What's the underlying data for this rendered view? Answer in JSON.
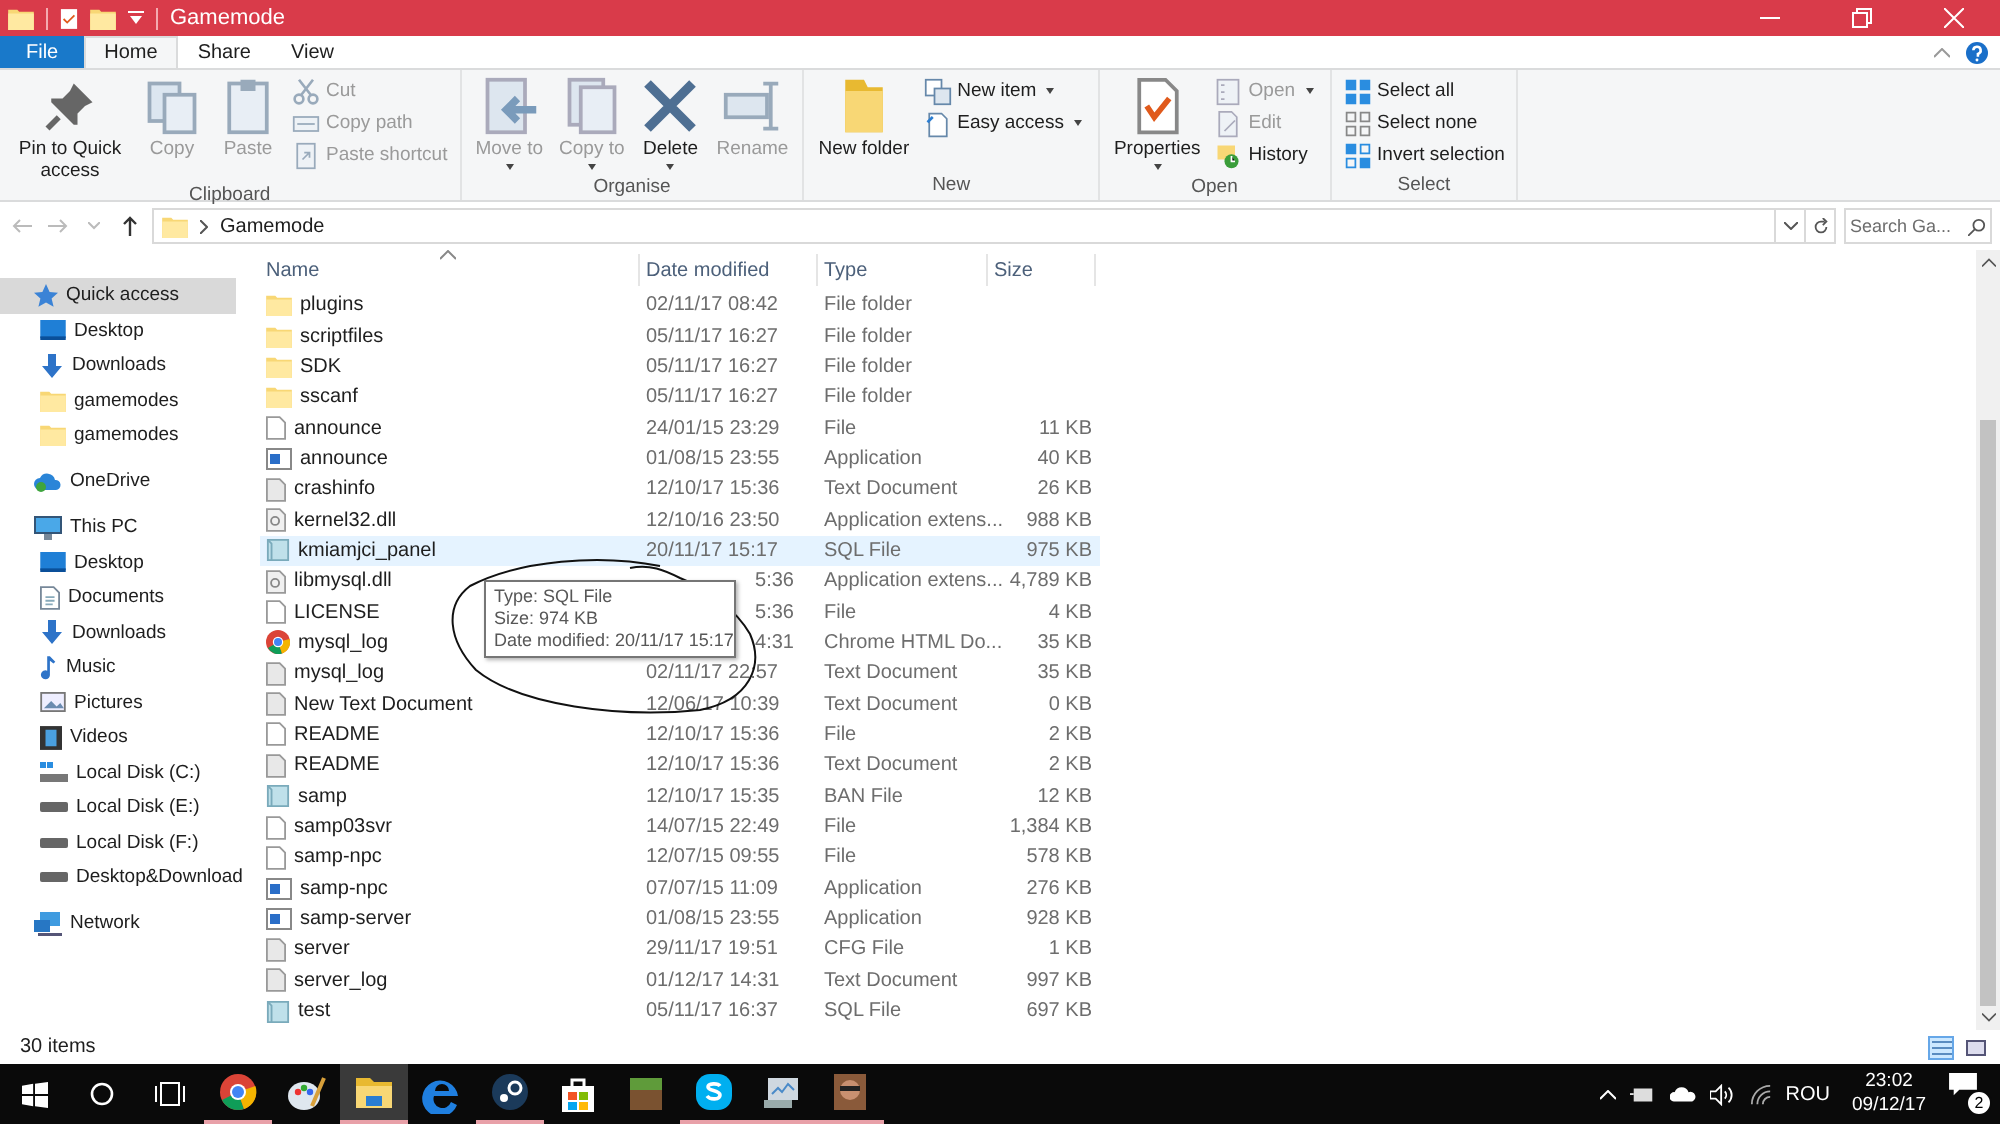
{
  "window": {
    "title": "Gamemode"
  },
  "ribbon_tabs": [
    {
      "label": "File",
      "kind": "file",
      "selected": false
    },
    {
      "label": "Home",
      "kind": "tab",
      "selected": true
    },
    {
      "label": "Share",
      "kind": "tab",
      "selected": false
    },
    {
      "label": "View",
      "kind": "tab",
      "selected": false
    }
  ],
  "ribbon_groups": [
    {
      "label": "Clipboard",
      "items": [
        {
          "kind": "large",
          "label": "Pin to Quick access",
          "disabled": false,
          "dropdown": false
        },
        {
          "kind": "large",
          "label": "Copy",
          "disabled": true,
          "dropdown": false
        },
        {
          "kind": "large",
          "label": "Paste",
          "disabled": true,
          "dropdown": false
        },
        {
          "kind": "stack",
          "items": [
            {
              "label": "Cut",
              "disabled": true,
              "dropdown": false
            },
            {
              "label": "Copy path",
              "disabled": true,
              "dropdown": false
            },
            {
              "label": "Paste shortcut",
              "disabled": true,
              "dropdown": false
            }
          ]
        }
      ]
    },
    {
      "label": "Organise",
      "items": [
        {
          "kind": "large",
          "label": "Move to",
          "disabled": true,
          "dropdown": true
        },
        {
          "kind": "large",
          "label": "Copy to",
          "disabled": true,
          "dropdown": true
        },
        {
          "kind": "large",
          "label": "Delete",
          "disabled": false,
          "dropdown": true
        },
        {
          "kind": "large",
          "label": "Rename",
          "disabled": true,
          "dropdown": false
        }
      ]
    },
    {
      "label": "New",
      "items": [
        {
          "kind": "large",
          "label": "New folder",
          "disabled": false,
          "dropdown": false
        },
        {
          "kind": "stack",
          "items": [
            {
              "label": "New item",
              "disabled": false,
              "dropdown": true
            },
            {
              "label": "Easy access",
              "disabled": false,
              "dropdown": true
            }
          ]
        }
      ]
    },
    {
      "label": "Open",
      "items": [
        {
          "kind": "large",
          "label": "Properties",
          "disabled": false,
          "dropdown": true
        },
        {
          "kind": "stack",
          "items": [
            {
              "label": "Open",
              "disabled": true,
              "dropdown": true
            },
            {
              "label": "Edit",
              "disabled": true,
              "dropdown": false
            },
            {
              "label": "History",
              "disabled": false,
              "dropdown": false
            }
          ]
        }
      ]
    },
    {
      "label": "Select",
      "items": [
        {
          "kind": "stack",
          "items": [
            {
              "label": "Select all",
              "disabled": false,
              "dropdown": false
            },
            {
              "label": "Select none",
              "disabled": false,
              "dropdown": false
            },
            {
              "label": "Invert selection",
              "disabled": false,
              "dropdown": false
            }
          ]
        }
      ]
    }
  ],
  "address": {
    "path": "Gamemode",
    "search_placeholder": "Search Ga..."
  },
  "navigation": [
    {
      "label": "Quick access",
      "kind": "star",
      "selected": true,
      "children": [
        {
          "label": "Desktop",
          "kind": "desktop",
          "selected": false
        },
        {
          "label": "Downloads",
          "kind": "download",
          "selected": false
        },
        {
          "label": "gamemodes",
          "kind": "folder",
          "selected": false
        },
        {
          "label": "gamemodes",
          "kind": "folder",
          "selected": false
        }
      ]
    },
    {
      "label": "OneDrive",
      "kind": "cloud",
      "selected": false
    },
    {
      "label": "This PC",
      "kind": "pc",
      "selected": false,
      "children": [
        {
          "label": "Desktop",
          "kind": "desktop",
          "selected": false
        },
        {
          "label": "Documents",
          "kind": "documents",
          "selected": false
        },
        {
          "label": "Downloads",
          "kind": "download",
          "selected": false
        },
        {
          "label": "Music",
          "kind": "music",
          "selected": false
        },
        {
          "label": "Pictures",
          "kind": "pictures",
          "selected": false
        },
        {
          "label": "Videos",
          "kind": "videos",
          "selected": false
        },
        {
          "label": "Local Disk (C:)",
          "kind": "sysdrive",
          "selected": false
        },
        {
          "label": "Local Disk (E:)",
          "kind": "drive",
          "selected": false
        },
        {
          "label": "Local Disk (F:)",
          "kind": "drive",
          "selected": false
        },
        {
          "label": "Desktop&Download",
          "kind": "drive",
          "selected": false
        }
      ]
    },
    {
      "label": "Network",
      "kind": "network",
      "selected": false
    }
  ],
  "table": {
    "columns": [
      "Name",
      "Date modified",
      "Type",
      "Size"
    ],
    "rows": [
      {
        "kind": "folder",
        "name": "plugins",
        "date": "02/11/17 08:42",
        "type": "File folder",
        "hovered": false
      },
      {
        "kind": "folder",
        "name": "scriptfiles",
        "date": "05/11/17 16:27",
        "type": "File folder",
        "hovered": false
      },
      {
        "kind": "folder",
        "name": "SDK",
        "date": "05/11/17 16:27",
        "type": "File folder",
        "hovered": false
      },
      {
        "kind": "folder",
        "name": "sscanf",
        "date": "05/11/17 16:27",
        "type": "File folder",
        "hovered": false
      },
      {
        "kind": "file",
        "name": "announce",
        "date": "24/01/15 23:29",
        "type": "File",
        "size": "11 KB",
        "hovered": false
      },
      {
        "kind": "app",
        "name": "announce",
        "date": "01/08/15 23:55",
        "type": "Application",
        "size": "40 KB",
        "hovered": false
      },
      {
        "kind": "text",
        "name": "crashinfo",
        "date": "12/10/17 15:36",
        "type": "Text Document",
        "size": "26 KB",
        "hovered": false
      },
      {
        "kind": "dll",
        "name": "kernel32.dll",
        "date": "12/10/16 23:50",
        "type": "Application extens...",
        "size": "988 KB",
        "hovered": false
      },
      {
        "kind": "sql",
        "name": "kmiamjci_panel",
        "date": "20/11/17 15:17",
        "type": "SQL File",
        "size": "975 KB",
        "hovered": true
      },
      {
        "kind": "dll",
        "name": "libmysql.dll",
        "date": "5:36",
        "date_covered": true,
        "type": "Application extens...",
        "size": "4,789 KB",
        "hovered": false
      },
      {
        "kind": "file",
        "name": "LICENSE",
        "date": "5:36",
        "date_covered": true,
        "type": "File",
        "size": "4 KB",
        "hovered": false
      },
      {
        "kind": "chrome",
        "name": "mysql_log",
        "date": "4:31",
        "date_covered": true,
        "type": "Chrome HTML Do...",
        "size": "35 KB",
        "hovered": false
      },
      {
        "kind": "text",
        "name": "mysql_log",
        "date": "02/11/17 22:57",
        "type": "Text Document",
        "size": "35 KB",
        "hovered": false
      },
      {
        "kind": "text",
        "name": "New Text Document",
        "date": "12/06/17 10:39",
        "type": "Text Document",
        "size": "0 KB",
        "hovered": false
      },
      {
        "kind": "file",
        "name": "README",
        "date": "12/10/17 15:36",
        "type": "File",
        "size": "2 KB",
        "hovered": false
      },
      {
        "kind": "text",
        "name": "README",
        "date": "12/10/17 15:36",
        "type": "Text Document",
        "size": "2 KB",
        "hovered": false
      },
      {
        "kind": "sql",
        "name": "samp",
        "date": "12/10/17 15:35",
        "type": "BAN File",
        "size": "12 KB",
        "hovered": false
      },
      {
        "kind": "file",
        "name": "samp03svr",
        "date": "14/07/15 22:49",
        "type": "File",
        "size": "1,384 KB",
        "hovered": false
      },
      {
        "kind": "file",
        "name": "samp-npc",
        "date": "12/07/15 09:55",
        "type": "File",
        "size": "578 KB",
        "hovered": false
      },
      {
        "kind": "app",
        "name": "samp-npc",
        "date": "07/07/15 11:09",
        "type": "Application",
        "size": "276 KB",
        "hovered": false
      },
      {
        "kind": "app",
        "name": "samp-server",
        "date": "01/08/15 23:55",
        "type": "Application",
        "size": "928 KB",
        "hovered": false
      },
      {
        "kind": "text",
        "name": "server",
        "date": "29/11/17 19:51",
        "type": "CFG File",
        "size": "1 KB",
        "hovered": false
      },
      {
        "kind": "text",
        "name": "server_log",
        "date": "01/12/17 14:31",
        "type": "Text Document",
        "size": "997 KB",
        "hovered": false
      },
      {
        "kind": "sql",
        "name": "test",
        "date": "05/11/17 16:37",
        "type": "SQL File",
        "size": "697 KB",
        "hovered": false
      }
    ]
  },
  "tooltip": {
    "lines": [
      "Type: SQL File",
      "Size: 974 KB",
      "Date modified: 20/11/17 15:17"
    ]
  },
  "status_bar": {
    "item_count": "30 items"
  },
  "taskbar": {
    "apps": [
      {
        "kind": "chrome",
        "running": true,
        "active": false
      },
      {
        "kind": "paint",
        "running": false,
        "active": false
      },
      {
        "kind": "explorer",
        "running": true,
        "active": true
      },
      {
        "kind": "edge",
        "running": false,
        "active": false
      },
      {
        "kind": "steam",
        "running": true,
        "active": false
      },
      {
        "kind": "store",
        "running": false,
        "active": false
      },
      {
        "kind": "block",
        "running": false,
        "active": false
      },
      {
        "kind": "skype",
        "running": true,
        "active": false
      },
      {
        "kind": "monitor",
        "running": true,
        "active": false
      },
      {
        "kind": "game",
        "running": true,
        "active": false
      }
    ],
    "language": "ROU",
    "time": "23:02",
    "date": "09/12/17",
    "notifications": "2"
  }
}
